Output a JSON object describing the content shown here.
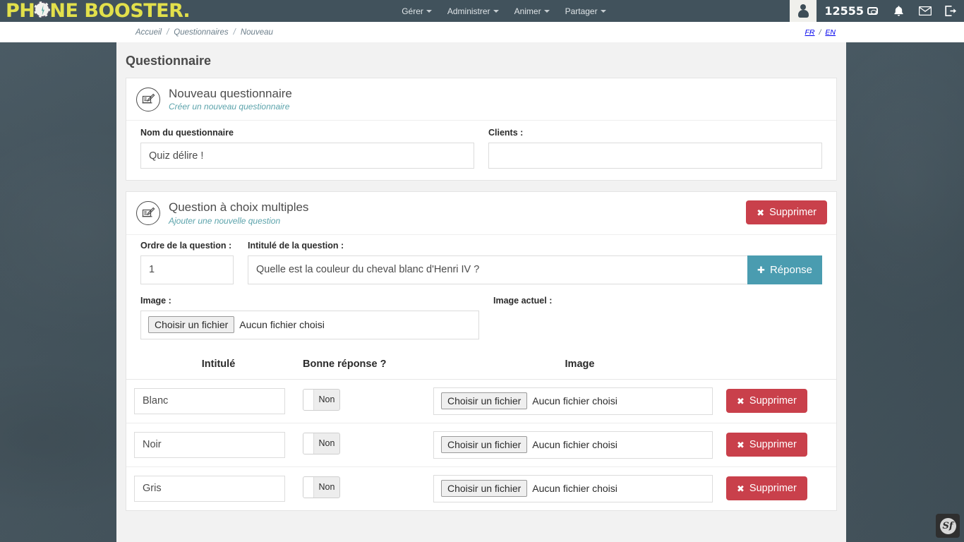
{
  "brand": {
    "logo_part1": "PH",
    "logo_part2": "NE BOOSTER",
    "logo_dot": ".",
    "logo_icon": "phone-dial-icon"
  },
  "topnav": {
    "items": [
      {
        "label": "Gérer",
        "icon": "chevron-down-icon"
      },
      {
        "label": "Administrer",
        "icon": "chevron-down-icon"
      },
      {
        "label": "Animer",
        "icon": "chevron-down-icon"
      },
      {
        "label": "Partager",
        "icon": "chevron-down-icon"
      }
    ],
    "avatar_icon": "user-avatar-icon",
    "credits": "12555",
    "credits_icon": "coins-icon",
    "notifications_icon": "bell-icon",
    "messages_icon": "envelope-icon",
    "logout_icon": "logout-icon"
  },
  "breadcrumb": {
    "items": [
      "Accueil",
      "Questionnaires",
      "Nouveau"
    ],
    "separator": "/"
  },
  "language": {
    "active": "FR",
    "separator": "/",
    "inactive": "EN"
  },
  "page": {
    "title": "Questionnaire"
  },
  "questionnaire_card": {
    "icon": "form-edit-icon",
    "title": "Nouveau questionnaire",
    "subtitle": "Créer un nouveau questionnaire",
    "name_label": "Nom du questionnaire",
    "name_value": "Quiz délire !",
    "clients_label": "Clients :",
    "clients_value": ""
  },
  "question_card": {
    "icon": "form-edit-icon",
    "title": "Question à choix multiples",
    "subtitle": "Ajouter une nouvelle question",
    "delete_button": {
      "label": "Supprimer",
      "icon": "cross-icon"
    },
    "ordre_label": "Ordre de la question :",
    "ordre_value": "1",
    "intitule_label": "Intitulé de la question :",
    "intitule_value": "Quelle est la couleur du cheval blanc d'Henri IV ?",
    "reponse_button": {
      "label": "Réponse",
      "icon": "plus-icon"
    },
    "image_label": "Image :",
    "image_actuel_label": "Image actuel :",
    "file_button": "Choisir un fichier",
    "file_status": "Aucun fichier choisi"
  },
  "answers_table": {
    "columns": [
      "Intitulé",
      "Bonne réponse ?",
      "Image",
      ""
    ],
    "file_button": "Choisir un fichier",
    "file_status": "Aucun fichier choisi",
    "delete_button": {
      "label": "Supprimer",
      "icon": "cross-icon"
    },
    "rows": [
      {
        "intitule": "Blanc",
        "bonne_reponse": "Non",
        "file_button": "Choisir un fichier",
        "file_status": "Aucun fichier choisi",
        "delete_label": "Supprimer"
      },
      {
        "intitule": "Noir",
        "bonne_reponse": "Non",
        "file_button": "Choisir un fichier",
        "file_status": "Aucun fichier choisi",
        "delete_label": "Supprimer"
      },
      {
        "intitule": "Gris",
        "bonne_reponse": "Non",
        "file_button": "Choisir un fichier",
        "file_status": "Aucun fichier choisi",
        "delete_label": "Supprimer"
      }
    ]
  },
  "debug_toolbar": {
    "label": "Sf",
    "icon": "symfony-icon"
  },
  "colors": {
    "brand_yellow": "#e2e04b",
    "header_slate": "#41525c",
    "backdrop": "#46565f",
    "teal": "#4a9cb0",
    "subtitle_teal": "#5ba3ab",
    "danger": "#c9404b",
    "page_bg": "#f2f2f2"
  }
}
